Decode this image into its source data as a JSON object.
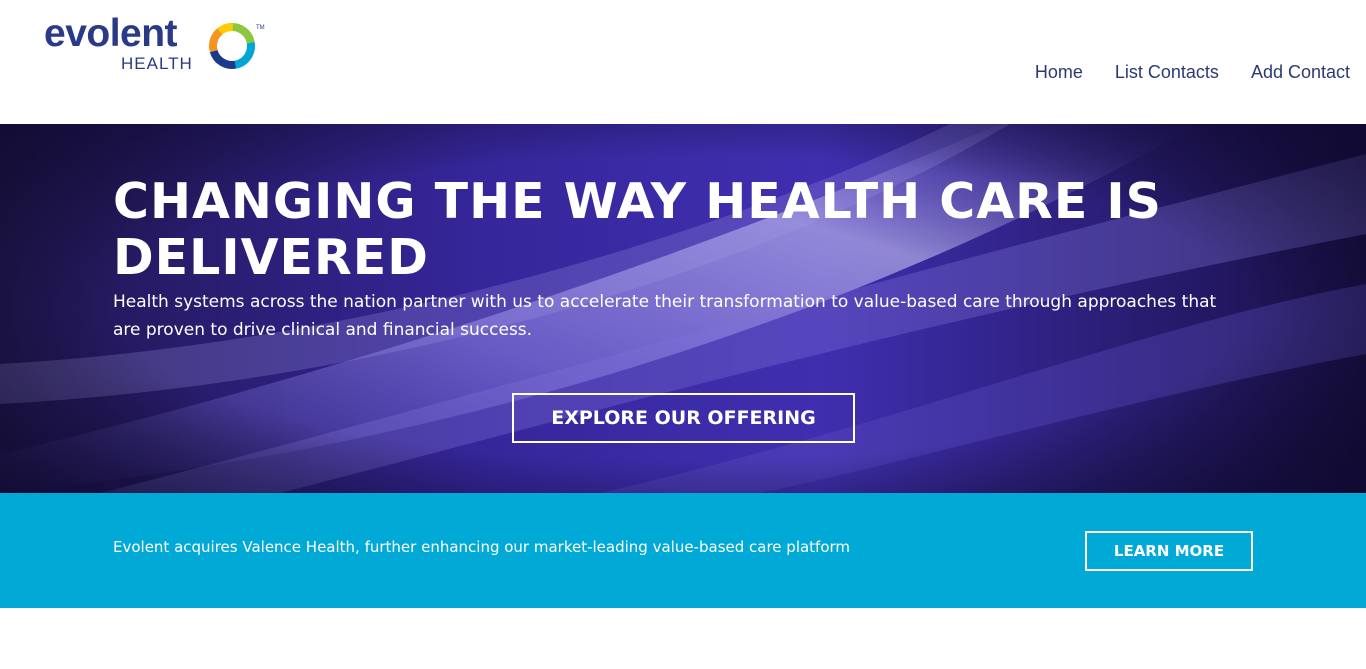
{
  "brand": {
    "name": "evolent",
    "subname": "HEALTH",
    "trademark": "TM",
    "colors": {
      "navy": "#2b3a87",
      "ring": [
        "#8dc63f",
        "#00a6d6",
        "#1b3a8c",
        "#f7941d",
        "#ffcb05"
      ]
    }
  },
  "nav": {
    "items": [
      {
        "label": "Home"
      },
      {
        "label": "List Contacts"
      },
      {
        "label": "Add Contact"
      }
    ]
  },
  "hero": {
    "title": "CHANGING THE WAY HEALTH CARE IS DELIVERED",
    "description": "Health systems across the nation partner with us to accelerate their transformation to value-based care through approaches that are proven to drive clinical and financial success.",
    "cta_label": "EXPLORE OUR OFFERING",
    "background_color": "#221858"
  },
  "announcement": {
    "text": "Evolent acquires Valence Health, further enhancing our market-leading value-based care platform",
    "cta_label": "LEARN MORE",
    "background_color": "#01aad6"
  }
}
